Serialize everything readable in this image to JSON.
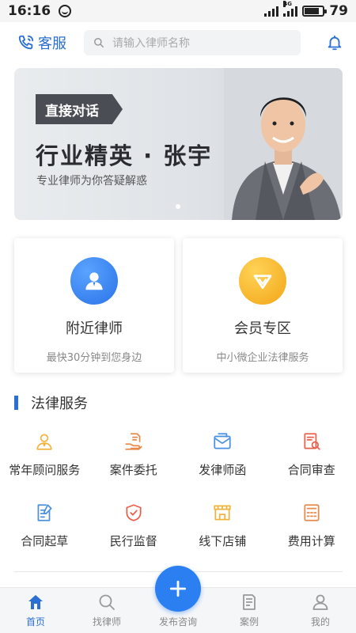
{
  "status_bar": {
    "time": "16:16",
    "network_tag": "4G",
    "battery_percent": "79",
    "battery_level": 0.79
  },
  "header": {
    "service_label": "客服",
    "search_placeholder": "请输入律师名称"
  },
  "banner": {
    "tag": "直接对话",
    "title": "行业精英 · 张宇",
    "subtitle": "专业律师为你答疑解惑"
  },
  "cards": [
    {
      "title": "附近律师",
      "subtitle": "最快30分钟到您身边",
      "icon": "person-icon",
      "color": "#2a73e8"
    },
    {
      "title": "会员专区",
      "subtitle": "中小微企业法律服务",
      "icon": "vip-badge-icon",
      "color": "#f2a516"
    }
  ],
  "section": {
    "title": "法律服务",
    "accent": "#2b6fd4"
  },
  "services": [
    {
      "label": "常年顾问服务",
      "icon": "consultant-icon",
      "color": "#f2b33d"
    },
    {
      "label": "案件委托",
      "icon": "hand-document-icon",
      "color": "#e8894a"
    },
    {
      "label": "发律师函",
      "icon": "letter-icon",
      "color": "#4a90e2"
    },
    {
      "label": "合同审查",
      "icon": "contract-review-icon",
      "color": "#e8604a"
    },
    {
      "label": "合同起草",
      "icon": "contract-draft-icon",
      "color": "#4a90e2"
    },
    {
      "label": "民行监督",
      "icon": "shield-check-icon",
      "color": "#e8604a"
    },
    {
      "label": "线下店铺",
      "icon": "store-icon",
      "color": "#f2b33d"
    },
    {
      "label": "费用计算",
      "icon": "calculator-icon",
      "color": "#e8894a"
    }
  ],
  "bottom_nav": [
    {
      "label": "首页",
      "icon": "home-icon",
      "active": true
    },
    {
      "label": "找律师",
      "icon": "search-icon",
      "active": false
    },
    {
      "label": "发布咨询",
      "icon": "plus-icon",
      "active": false
    },
    {
      "label": "案例",
      "icon": "case-book-icon",
      "active": false
    },
    {
      "label": "我的",
      "icon": "profile-icon",
      "active": false
    }
  ]
}
